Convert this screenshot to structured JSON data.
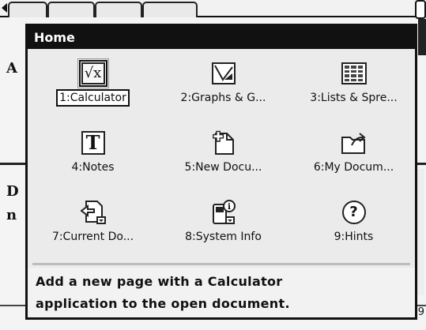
{
  "menu": {
    "title": "Home",
    "apps": [
      {
        "label": "1:Calculator",
        "icon": "calculator-sqrt-icon",
        "selected": true
      },
      {
        "label": "2:Graphs & G...",
        "icon": "graphs-icon"
      },
      {
        "label": "3:Lists & Spre...",
        "icon": "spreadsheet-icon"
      },
      {
        "label": "4:Notes",
        "icon": "notes-T-icon"
      },
      {
        "label": "5:New Docu...",
        "icon": "new-document-icon"
      },
      {
        "label": "6:My Docum...",
        "icon": "my-documents-folder-icon"
      },
      {
        "label": "7:Current Do...",
        "icon": "current-document-icon"
      },
      {
        "label": "8:System Info",
        "icon": "system-info-icon"
      },
      {
        "label": "9:Hints",
        "icon": "hint-question-icon"
      }
    ],
    "description": {
      "line1": "Add a new page with a Calculator",
      "line2": "application to the open document."
    }
  },
  "background": {
    "letters": [
      "A",
      "D",
      "n"
    ],
    "page_number": "9"
  },
  "colors": {
    "header_bg": "#111111",
    "menu_bg": "#ebebeb",
    "selection_border": "#111111"
  }
}
